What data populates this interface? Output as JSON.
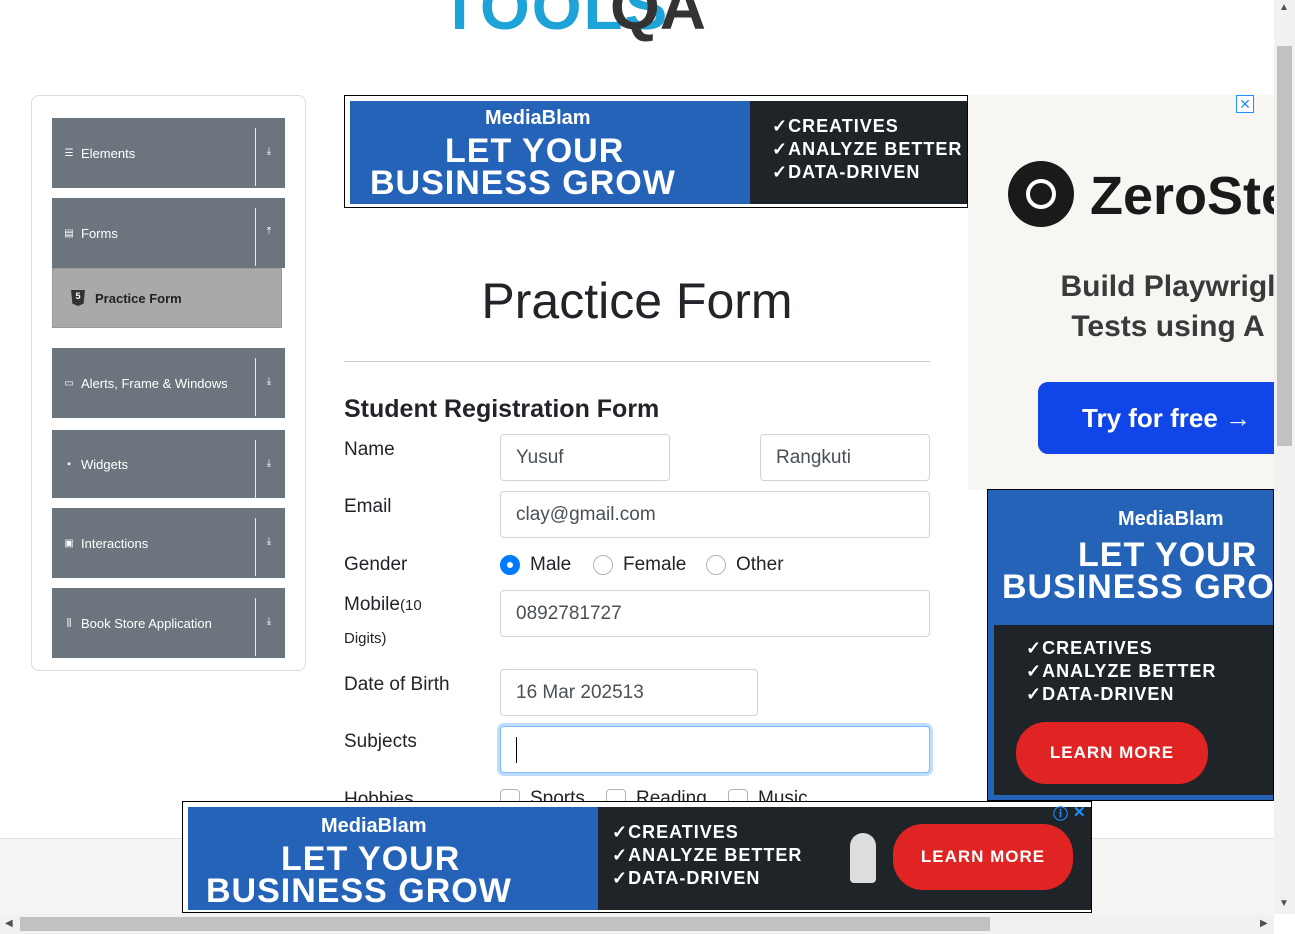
{
  "logo": {
    "word": "TOOLS",
    "suffix": "QA"
  },
  "sidebar": {
    "groups": [
      {
        "label": "Elements",
        "icon": "hamburger-icon",
        "arrow": "⤓"
      },
      {
        "label": "Forms",
        "icon": "document-icon",
        "arrow": "⤒"
      },
      {
        "label": "Alerts, Frame & Windows",
        "icon": "window-icon",
        "arrow": "⤓"
      },
      {
        "label": "Widgets",
        "icon": "grid-icon",
        "arrow": "⤓"
      },
      {
        "label": "Interactions",
        "icon": "interactions-icon",
        "arrow": "⤓"
      },
      {
        "label": "Book Store Application",
        "icon": "books-icon",
        "arrow": "⤓"
      }
    ],
    "active_item": {
      "label": "Practice Form",
      "icon": "html5-icon"
    }
  },
  "ads": {
    "brand": "MediaBlam",
    "headline_1": "LET YOUR",
    "headline_2": "BUSINESS GROW",
    "bullets": [
      "✓CREATIVES",
      "✓ANALYZE BETTER",
      "✓DATA-DRIVEN"
    ],
    "cta": "LEARN MORE",
    "zerostep": {
      "name": "ZeroSte",
      "tagline_1": "Build Playwrigl",
      "tagline_2": "Tests using A",
      "button": "Try for free →"
    },
    "close_glyph": "✕",
    "info_glyph": "ⓘ"
  },
  "page": {
    "title": "Practice Form",
    "form_title": "Student Registration Form"
  },
  "form": {
    "name_label": "Name",
    "first_name": "Yusuf",
    "last_name": "Rangkuti",
    "email_label": "Email",
    "email": "clay@gmail.com",
    "gender_label": "Gender",
    "genders": [
      {
        "label": "Male",
        "checked": true
      },
      {
        "label": "Female",
        "checked": false
      },
      {
        "label": "Other",
        "checked": false
      }
    ],
    "mobile_label": "Mobile",
    "mobile_hint_1": "(10",
    "mobile_hint_2": "Digits)",
    "mobile": "0892781727",
    "dob_label": "Date of Birth",
    "dob": "16 Mar 202513",
    "subjects_label": "Subjects",
    "hobbies_label": "Hobbies",
    "hobbies": [
      "Sports",
      "Reading",
      "Music"
    ]
  },
  "colors": {
    "sidebar_group": "#6c757d",
    "active_item": "#a9a9a9",
    "primary": "#007bff",
    "logo_blue": "#1ea3d9"
  }
}
